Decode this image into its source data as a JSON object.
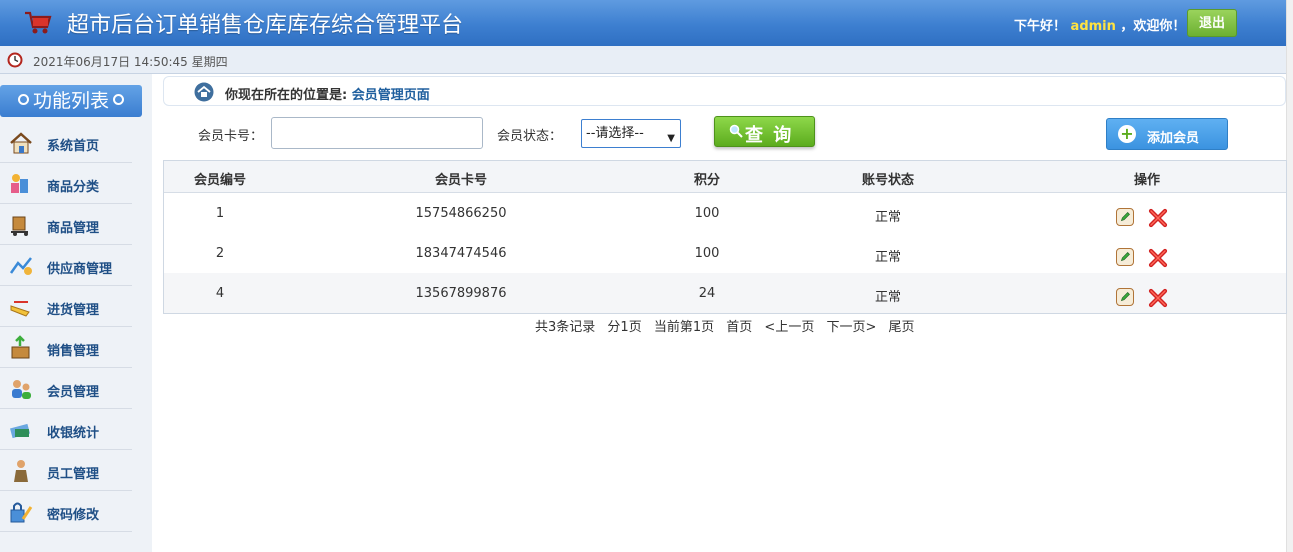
{
  "header": {
    "app_title": "超市后台订单销售仓库库存综合管理平台",
    "greeting_prefix": "下午好！",
    "username": "admin",
    "greeting_suffix": "，欢迎你！",
    "logout_label": "退出"
  },
  "datebar": {
    "datetime": "2021年06月17日 14:50:45 星期四"
  },
  "sidebar": {
    "title": "功能列表",
    "items": [
      {
        "label": "系统首页",
        "icon": "home-house-icon"
      },
      {
        "label": "商品分类",
        "icon": "category-icon"
      },
      {
        "label": "商品管理",
        "icon": "goods-cart-icon"
      },
      {
        "label": "供应商管理",
        "icon": "supplier-icon"
      },
      {
        "label": "进货管理",
        "icon": "purchase-icon"
      },
      {
        "label": "销售管理",
        "icon": "sales-box-icon"
      },
      {
        "label": "会员管理",
        "icon": "members-icon"
      },
      {
        "label": "收银统计",
        "icon": "cashier-icon"
      },
      {
        "label": "员工管理",
        "icon": "employee-icon"
      },
      {
        "label": "密码修改",
        "icon": "password-icon"
      }
    ]
  },
  "breadcrumb": {
    "prefix": "你现在所在的位置是:",
    "current": "会员管理页面"
  },
  "search": {
    "card_label": "会员卡号：",
    "card_value": "",
    "status_label": "会员状态：",
    "status_selected": "--请选择--",
    "query_label": "查 询",
    "add_label": "添加会员"
  },
  "table": {
    "columns": [
      "会员编号",
      "会员卡号",
      "积分",
      "账号状态",
      "操作"
    ],
    "rows": [
      {
        "id": "1",
        "card": "15754866250",
        "points": "100",
        "status": "正常"
      },
      {
        "id": "2",
        "card": "18347474546",
        "points": "100",
        "status": "正常"
      },
      {
        "id": "4",
        "card": "13567899876",
        "points": "24",
        "status": "正常"
      }
    ]
  },
  "pager": {
    "total": "共3条记录",
    "pages": "分1页",
    "current": "当前第1页",
    "first": "首页",
    "prev": "<上一页",
    "next": "下一页>",
    "last": "尾页"
  },
  "colors": {
    "header_blue": "#3d7fd0",
    "accent_green": "#6cb032",
    "username_yellow": "#ffe340",
    "delete_red": "#d22222"
  }
}
